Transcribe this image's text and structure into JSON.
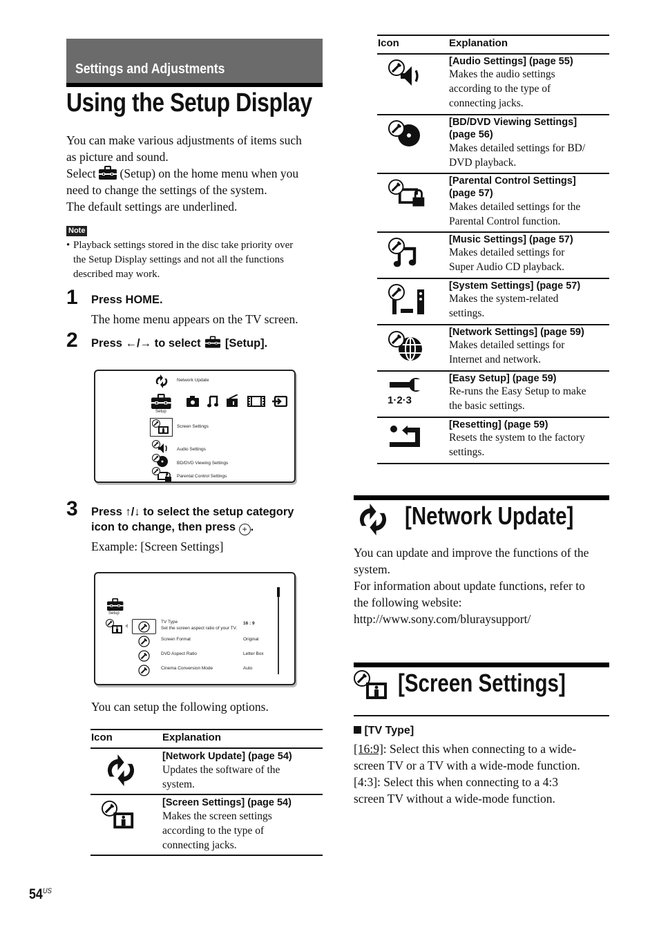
{
  "header": {
    "section": "Settings and Adjustments",
    "title": "Using the Setup Display"
  },
  "intro": {
    "line1": "You can make various adjustments of items such",
    "line2": "as picture and sound.",
    "line3_pre": "Select",
    "line3_post": "(Setup) on the home menu when you",
    "line4": "need to change the settings of the system.",
    "line5": "The default settings are underlined."
  },
  "note": {
    "label": "Note",
    "bullet": "•",
    "line1": "Playback settings stored in the disc take priority over",
    "line2": "the Setup Display settings and not all the functions",
    "line3": "described may work."
  },
  "steps": [
    {
      "num": "1",
      "title": "Press HOME.",
      "detail": "The home menu appears on the TV screen."
    },
    {
      "num": "2",
      "title_pre": "Press ←/→ to select",
      "title_post": "[Setup]."
    },
    {
      "num": "3",
      "line1": "Press ↑/↓ to select the setup category",
      "line2": "icon to change, then press",
      "enter_symbol": "+",
      "line2_end": ".",
      "detail": "Example: [Screen Settings]"
    }
  ],
  "home_menu_screen": {
    "network_update": "Network Update",
    "setup": "Setup",
    "screen_settings": "Screen Settings",
    "audio_settings": "Audio Settings",
    "bd_dvd_settings": "BD/DVD Viewing Settings",
    "parental_settings": "Parental Control Settings",
    "category_icons": [
      "camera-icon",
      "music-note-icon",
      "radio-icon",
      "film-icon",
      "input-icon"
    ]
  },
  "screen_settings_screen": {
    "setup": "Setup",
    "items": [
      {
        "name": "TV Type",
        "desc": "Set the screen aspect ratio of your TV.",
        "value": "16 : 9"
      },
      {
        "name": "Screen Format",
        "value": "Original"
      },
      {
        "name": "DVD Aspect Ratio",
        "value": "Letter Box"
      },
      {
        "name": "Cinema Conversion Mode",
        "value": "Auto"
      }
    ]
  },
  "options_intro": "You can setup the following options.",
  "table": {
    "col_icon": "Icon",
    "col_explanation": "Explanation",
    "left_rows": [
      {
        "icon": "network-update-icon",
        "title": "[Network Update] (page 54)",
        "desc": [
          "Updates the software of the",
          "system."
        ]
      },
      {
        "icon": "screen-settings-icon",
        "title": "[Screen Settings] (page 54)",
        "desc": [
          "Makes the screen settings",
          "according to the type of",
          "connecting jacks."
        ]
      }
    ],
    "right_rows": [
      {
        "icon": "audio-settings-icon",
        "title": [
          "[Audio Settings] (page 55)"
        ],
        "desc": [
          "Makes the audio settings",
          "according to the type of",
          "connecting jacks."
        ]
      },
      {
        "icon": "bd-dvd-settings-icon",
        "title": [
          "[BD/DVD Viewing Settings]",
          "(page 56)"
        ],
        "desc": [
          "Makes detailed settings for BD/",
          "DVD playback."
        ]
      },
      {
        "icon": "parental-control-icon",
        "title": [
          "[Parental Control Settings]",
          "(page 57)"
        ],
        "desc": [
          "Makes detailed settings for the",
          "Parental Control function."
        ]
      },
      {
        "icon": "music-settings-icon",
        "title": [
          "[Music Settings] (page 57)"
        ],
        "desc": [
          "Makes detailed settings for",
          "Super Audio CD playback."
        ]
      },
      {
        "icon": "system-settings-icon",
        "title": [
          "[System Settings] (page 57)"
        ],
        "desc": [
          "Makes the system-related",
          "settings."
        ]
      },
      {
        "icon": "network-settings-icon",
        "title": [
          "[Network Settings] (page 59)"
        ],
        "desc": [
          "Makes detailed settings for",
          "Internet and network."
        ]
      },
      {
        "icon": "easy-setup-icon",
        "title": [
          "[Easy Setup] (page 59)"
        ],
        "desc": [
          "Re-runs the Easy Setup to make",
          "the basic settings."
        ],
        "icon_label": "1·2·3"
      },
      {
        "icon": "resetting-icon",
        "title": [
          "[Resetting] (page 59)"
        ],
        "desc": [
          "Resets the system to the factory",
          "settings."
        ]
      }
    ]
  },
  "network_update": {
    "heading": "[Network Update]",
    "lines": [
      "You can update and improve the functions of the",
      "system.",
      "For information about update functions, refer to",
      "the following website:",
      "http://www.sony.com/bluraysupport/"
    ]
  },
  "screen_settings": {
    "heading": "[Screen Settings]",
    "subheading": "[TV Type]",
    "opt1_label": "[16:9]",
    "opt1_text": ": Select this when connecting to a wide-",
    "opt1_line2": "screen TV or a TV with a wide-mode function.",
    "opt2_line1": "[4:3]: Select this when connecting to a 4:3",
    "opt2_line2": "screen TV without a wide-mode function."
  },
  "footer": {
    "page_number": "54",
    "region": "US"
  }
}
